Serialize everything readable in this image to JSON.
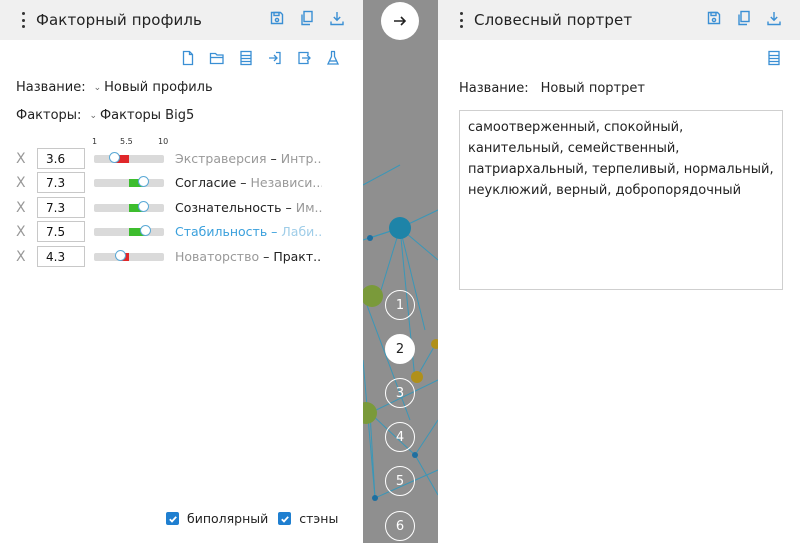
{
  "left_panel": {
    "title": "Факторный профиль",
    "name_label": "Название:",
    "name_value": "Новый профиль",
    "factors_label": "Факторы:",
    "factors_value": "Факторы Big5",
    "scale": {
      "min": "1",
      "mid": "5.5",
      "max": "10"
    },
    "factors": [
      {
        "value": "3.6",
        "level": 3.6,
        "name_a": "Экстраверсия",
        "dash": " – ",
        "name_b": "Интр...",
        "style": "gray-a",
        "fill": "red"
      },
      {
        "value": "7.3",
        "level": 7.3,
        "name_a": "Согласие",
        "dash": " – ",
        "name_b": "Независи...",
        "style": "normal",
        "fill": "green"
      },
      {
        "value": "7.3",
        "level": 7.3,
        "name_a": "Сознательность",
        "dash": " – ",
        "name_b": "Им...",
        "style": "normal",
        "fill": "green"
      },
      {
        "value": "7.5",
        "level": 7.5,
        "name_a": "Стабильность",
        "dash": " – ",
        "name_b": "Лаби...",
        "style": "blue",
        "fill": "green"
      },
      {
        "value": "4.3",
        "level": 4.3,
        "name_a": "Новаторство",
        "dash": " – ",
        "name_b": "Практ...",
        "style": "gray-a-dark-b",
        "fill": "red"
      }
    ],
    "remove_symbol": "X",
    "check_bipolar": "биполярный",
    "check_stens": "стэны"
  },
  "right_panel": {
    "title": "Словесный портрет",
    "name_label": "Название:",
    "name_value": "Новый портрет",
    "portrait_text": "самоотверженный, спокойный, канительный, семейственный, патриархальный, терпеливый, нормальный, неуклюжий, верный, добропорядочный"
  },
  "center": {
    "arrow": "→",
    "steps": [
      "1",
      "2",
      "3",
      "4",
      "5",
      "6"
    ],
    "active_step": "2"
  },
  "colors": {
    "accent": "#1f7fd0",
    "icon_blue": "#3a8fd4",
    "slider_green": "#3dbd2e",
    "slider_red": "#e0272a",
    "header_bg": "#f0f0f0"
  }
}
